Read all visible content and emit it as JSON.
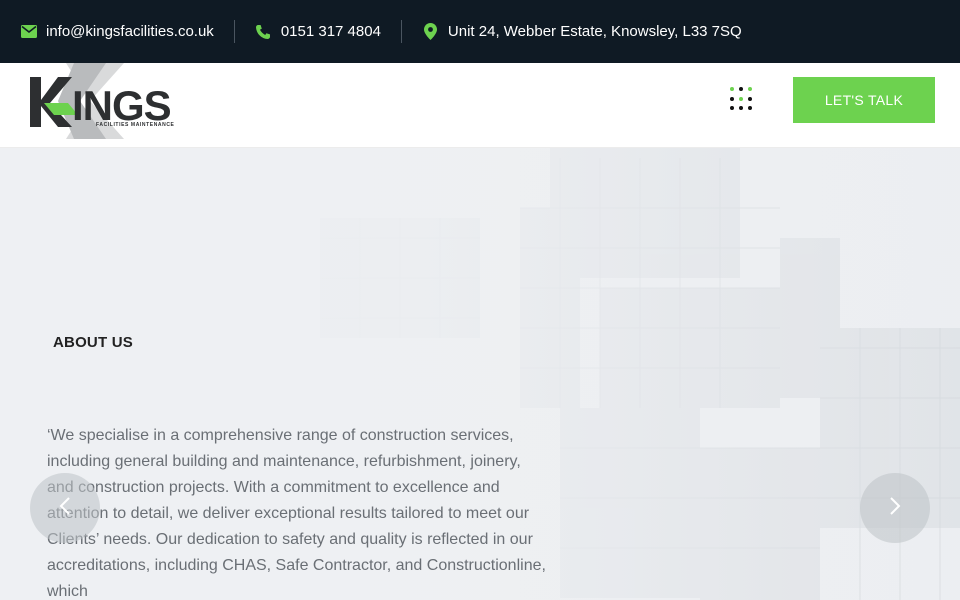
{
  "topbar": {
    "email": "info@kingsfacilities.co.uk",
    "phone": "0151 317 4804",
    "address": "Unit 24, Webber Estate, Knowsley, L33 7SQ",
    "icons": {
      "email": "envelope-icon",
      "phone": "phone-icon",
      "address": "map-pin-icon"
    }
  },
  "header": {
    "logo": {
      "brand": "KINGS",
      "tagline": "FACILITIES MAINTENANCE"
    },
    "menu_icon": "grid-dots-icon",
    "cta_label": "LET'S TALK"
  },
  "hero": {
    "eyebrow": "ABOUT US",
    "text": "‘We specialise in a comprehensive range of construction services, including general building and maintenance, refurbishment, joinery, and construction projects. With a commitment to excellence and attention to detail, we deliver exceptional results tailored to meet our Clients’ needs. Our dedication to safety and quality is reflected in our accreditations, including CHAS, Safe Contractor, and Constructionline, which",
    "prev_icon": "chevron-left-icon",
    "next_icon": "chevron-right-icon"
  },
  "colors": {
    "accent": "#6dd24f",
    "topbar_bg": "#0f1a24",
    "text_muted": "#6a6f75"
  }
}
